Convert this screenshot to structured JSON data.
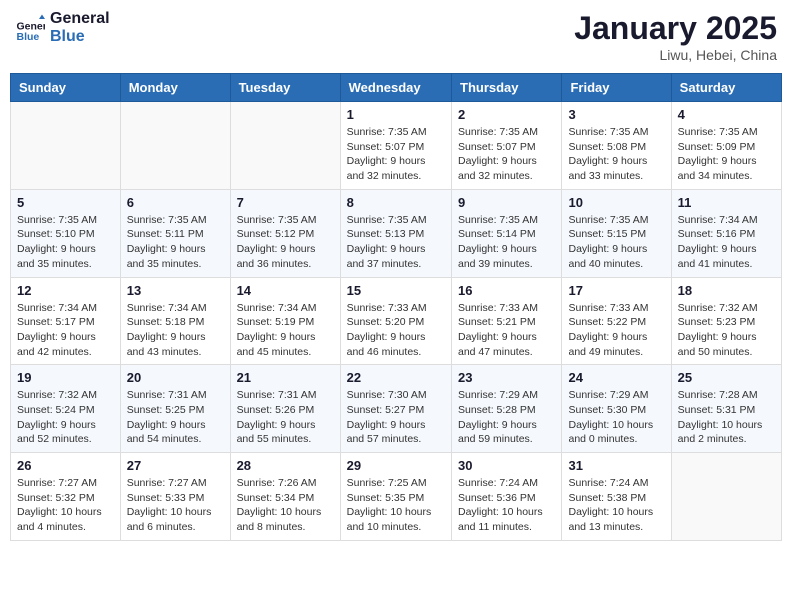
{
  "logo": {
    "line1": "General",
    "line2": "Blue"
  },
  "header": {
    "title": "January 2025",
    "location": "Liwu, Hebei, China"
  },
  "weekdays": [
    "Sunday",
    "Monday",
    "Tuesday",
    "Wednesday",
    "Thursday",
    "Friday",
    "Saturday"
  ],
  "weeks": [
    [
      {
        "day": "",
        "info": ""
      },
      {
        "day": "",
        "info": ""
      },
      {
        "day": "",
        "info": ""
      },
      {
        "day": "1",
        "info": "Sunrise: 7:35 AM\nSunset: 5:07 PM\nDaylight: 9 hours and 32 minutes."
      },
      {
        "day": "2",
        "info": "Sunrise: 7:35 AM\nSunset: 5:07 PM\nDaylight: 9 hours and 32 minutes."
      },
      {
        "day": "3",
        "info": "Sunrise: 7:35 AM\nSunset: 5:08 PM\nDaylight: 9 hours and 33 minutes."
      },
      {
        "day": "4",
        "info": "Sunrise: 7:35 AM\nSunset: 5:09 PM\nDaylight: 9 hours and 34 minutes."
      }
    ],
    [
      {
        "day": "5",
        "info": "Sunrise: 7:35 AM\nSunset: 5:10 PM\nDaylight: 9 hours and 35 minutes."
      },
      {
        "day": "6",
        "info": "Sunrise: 7:35 AM\nSunset: 5:11 PM\nDaylight: 9 hours and 35 minutes."
      },
      {
        "day": "7",
        "info": "Sunrise: 7:35 AM\nSunset: 5:12 PM\nDaylight: 9 hours and 36 minutes."
      },
      {
        "day": "8",
        "info": "Sunrise: 7:35 AM\nSunset: 5:13 PM\nDaylight: 9 hours and 37 minutes."
      },
      {
        "day": "9",
        "info": "Sunrise: 7:35 AM\nSunset: 5:14 PM\nDaylight: 9 hours and 39 minutes."
      },
      {
        "day": "10",
        "info": "Sunrise: 7:35 AM\nSunset: 5:15 PM\nDaylight: 9 hours and 40 minutes."
      },
      {
        "day": "11",
        "info": "Sunrise: 7:34 AM\nSunset: 5:16 PM\nDaylight: 9 hours and 41 minutes."
      }
    ],
    [
      {
        "day": "12",
        "info": "Sunrise: 7:34 AM\nSunset: 5:17 PM\nDaylight: 9 hours and 42 minutes."
      },
      {
        "day": "13",
        "info": "Sunrise: 7:34 AM\nSunset: 5:18 PM\nDaylight: 9 hours and 43 minutes."
      },
      {
        "day": "14",
        "info": "Sunrise: 7:34 AM\nSunset: 5:19 PM\nDaylight: 9 hours and 45 minutes."
      },
      {
        "day": "15",
        "info": "Sunrise: 7:33 AM\nSunset: 5:20 PM\nDaylight: 9 hours and 46 minutes."
      },
      {
        "day": "16",
        "info": "Sunrise: 7:33 AM\nSunset: 5:21 PM\nDaylight: 9 hours and 47 minutes."
      },
      {
        "day": "17",
        "info": "Sunrise: 7:33 AM\nSunset: 5:22 PM\nDaylight: 9 hours and 49 minutes."
      },
      {
        "day": "18",
        "info": "Sunrise: 7:32 AM\nSunset: 5:23 PM\nDaylight: 9 hours and 50 minutes."
      }
    ],
    [
      {
        "day": "19",
        "info": "Sunrise: 7:32 AM\nSunset: 5:24 PM\nDaylight: 9 hours and 52 minutes."
      },
      {
        "day": "20",
        "info": "Sunrise: 7:31 AM\nSunset: 5:25 PM\nDaylight: 9 hours and 54 minutes."
      },
      {
        "day": "21",
        "info": "Sunrise: 7:31 AM\nSunset: 5:26 PM\nDaylight: 9 hours and 55 minutes."
      },
      {
        "day": "22",
        "info": "Sunrise: 7:30 AM\nSunset: 5:27 PM\nDaylight: 9 hours and 57 minutes."
      },
      {
        "day": "23",
        "info": "Sunrise: 7:29 AM\nSunset: 5:28 PM\nDaylight: 9 hours and 59 minutes."
      },
      {
        "day": "24",
        "info": "Sunrise: 7:29 AM\nSunset: 5:30 PM\nDaylight: 10 hours and 0 minutes."
      },
      {
        "day": "25",
        "info": "Sunrise: 7:28 AM\nSunset: 5:31 PM\nDaylight: 10 hours and 2 minutes."
      }
    ],
    [
      {
        "day": "26",
        "info": "Sunrise: 7:27 AM\nSunset: 5:32 PM\nDaylight: 10 hours and 4 minutes."
      },
      {
        "day": "27",
        "info": "Sunrise: 7:27 AM\nSunset: 5:33 PM\nDaylight: 10 hours and 6 minutes."
      },
      {
        "day": "28",
        "info": "Sunrise: 7:26 AM\nSunset: 5:34 PM\nDaylight: 10 hours and 8 minutes."
      },
      {
        "day": "29",
        "info": "Sunrise: 7:25 AM\nSunset: 5:35 PM\nDaylight: 10 hours and 10 minutes."
      },
      {
        "day": "30",
        "info": "Sunrise: 7:24 AM\nSunset: 5:36 PM\nDaylight: 10 hours and 11 minutes."
      },
      {
        "day": "31",
        "info": "Sunrise: 7:24 AM\nSunset: 5:38 PM\nDaylight: 10 hours and 13 minutes."
      },
      {
        "day": "",
        "info": ""
      }
    ]
  ]
}
